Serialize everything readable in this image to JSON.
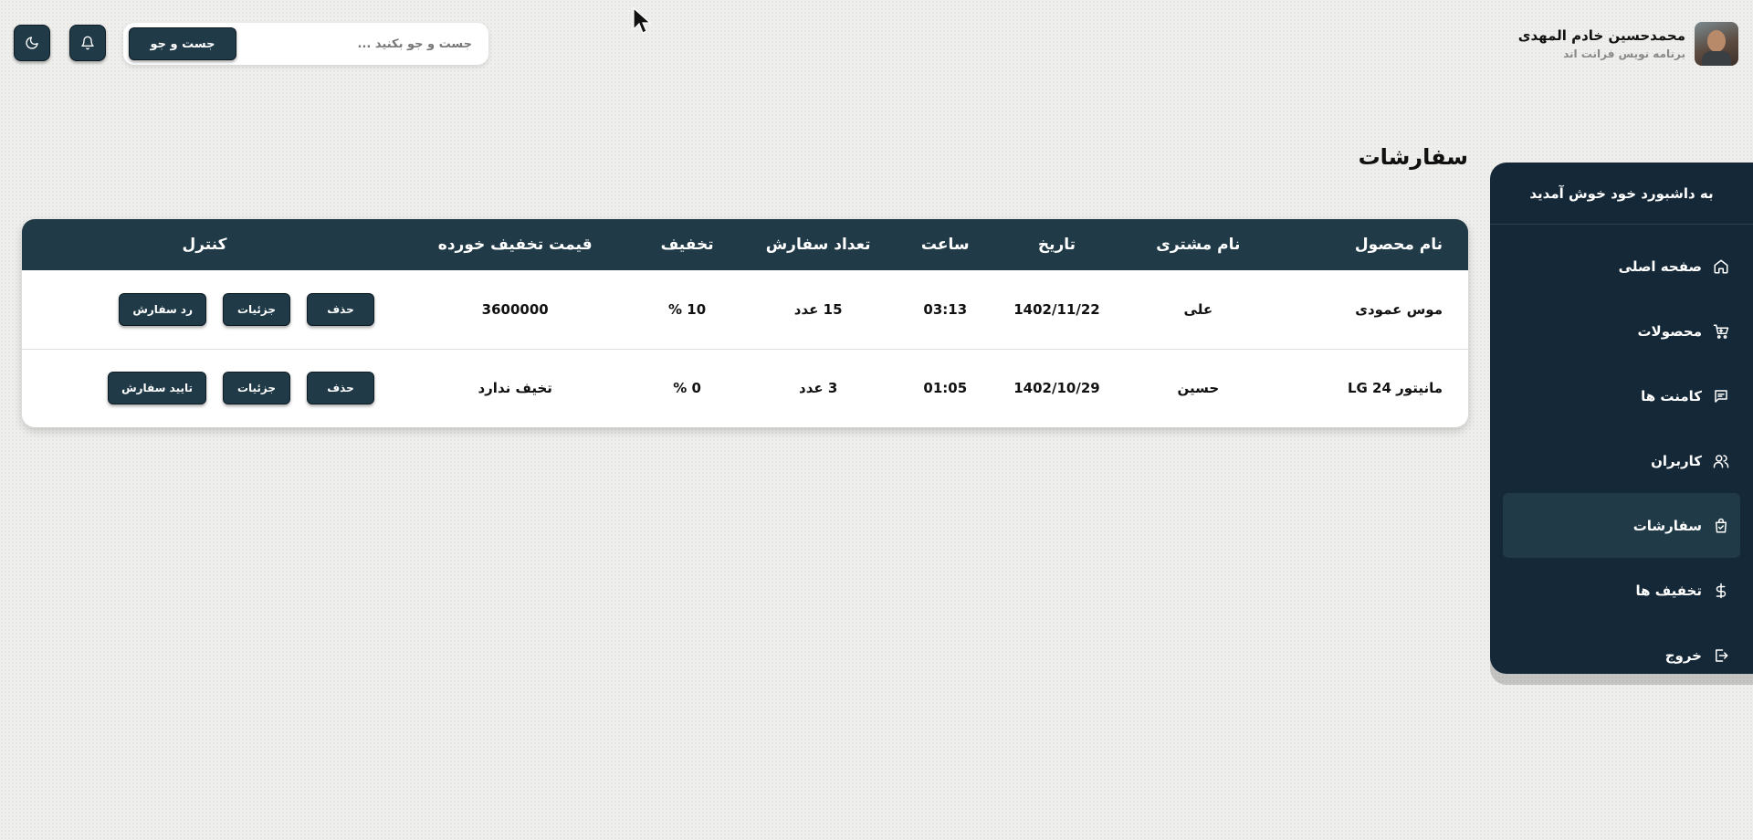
{
  "header": {
    "profile_name": "محمدحسین خادم المهدی",
    "profile_role": "برنامه نویس فرانت اند",
    "search_placeholder": "جست و جو بکنید ...",
    "search_button": "جست و جو",
    "bell_icon": "bell-icon",
    "moon_icon": "moon-icon"
  },
  "sidebar": {
    "title": "به داشبورد خود خوش آمدید",
    "items": [
      {
        "label": "صفحه اصلی",
        "icon": "home-icon"
      },
      {
        "label": "محصولات",
        "icon": "cart-icon"
      },
      {
        "label": "کامنت ها",
        "icon": "comment-icon"
      },
      {
        "label": "کاربران",
        "icon": "users-icon"
      },
      {
        "label": "سفارشات",
        "icon": "bag-check-icon",
        "active": true
      },
      {
        "label": "تخفیف ها",
        "icon": "dollar-icon"
      },
      {
        "label": "خروج",
        "icon": "logout-icon"
      }
    ]
  },
  "main": {
    "title": "سفارشات",
    "columns": [
      "نام محصول",
      "نام مشتری",
      "تاریخ",
      "ساعت",
      "تعداد سفارش",
      "تخفیف",
      "قیمت تخفیف خورده",
      "کنترل"
    ],
    "rows": [
      {
        "product": "موس عمودی",
        "customer": "علی",
        "date": "1402/11/22",
        "time": "03:13",
        "count": "15 عدد",
        "discount": "10 %",
        "discounted_price": "3600000",
        "actions": [
          "حذف",
          "جزئیات",
          "رد سفارش"
        ]
      },
      {
        "product": "مانیتور LG 24",
        "customer": "حسین",
        "date": "1402/10/29",
        "time": "01:05",
        "count": "3 عدد",
        "discount": "0 %",
        "discounted_price": "تخیف ندارد",
        "actions": [
          "حذف",
          "جزئیات",
          "تایید سفارش"
        ]
      }
    ]
  },
  "colors": {
    "primary": "#203a48",
    "sidebar_bg": "#152837",
    "background": "#efefed"
  }
}
